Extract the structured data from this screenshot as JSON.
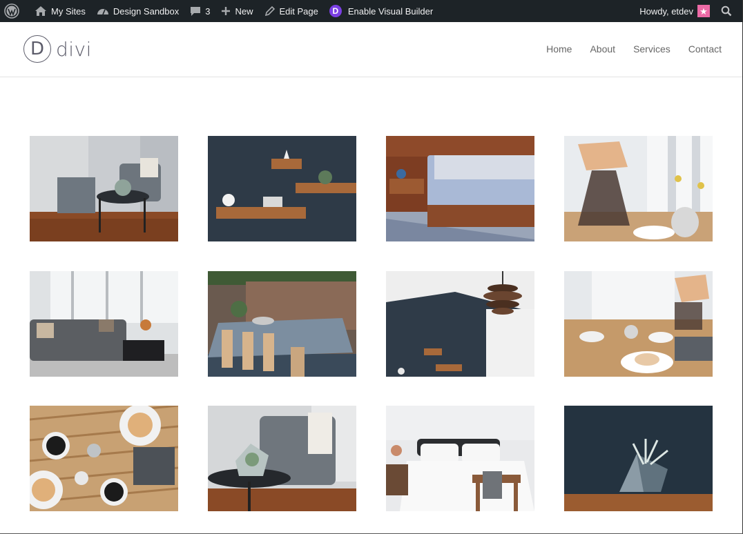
{
  "adminbar": {
    "my_sites": "My Sites",
    "site_name": "Design Sandbox",
    "comments_count": "3",
    "new_label": "New",
    "edit_page": "Edit Page",
    "divi_letter": "D",
    "visual_builder": "Enable Visual Builder",
    "howdy": "Howdy, etdev"
  },
  "header": {
    "logo_letter": "D",
    "logo_text": "divi",
    "nav": [
      "Home",
      "About",
      "Services",
      "Contact"
    ]
  },
  "gallery": {
    "images": [
      {
        "subject": "living-room-chair-ottoman"
      },
      {
        "subject": "floating-wall-shelves"
      },
      {
        "subject": "wooden-platform-bed"
      },
      {
        "subject": "chemex-coffee-balcony"
      },
      {
        "subject": "grey-sectional-sofa"
      },
      {
        "subject": "outdoor-dining-table"
      },
      {
        "subject": "spiral-pendant-lamp"
      },
      {
        "subject": "breakfast-table-setting"
      },
      {
        "subject": "coffee-and-donuts-overhead"
      },
      {
        "subject": "armchair-terrarium"
      },
      {
        "subject": "white-bedroom-stool"
      },
      {
        "subject": "geometric-terrarium-dark"
      }
    ]
  }
}
